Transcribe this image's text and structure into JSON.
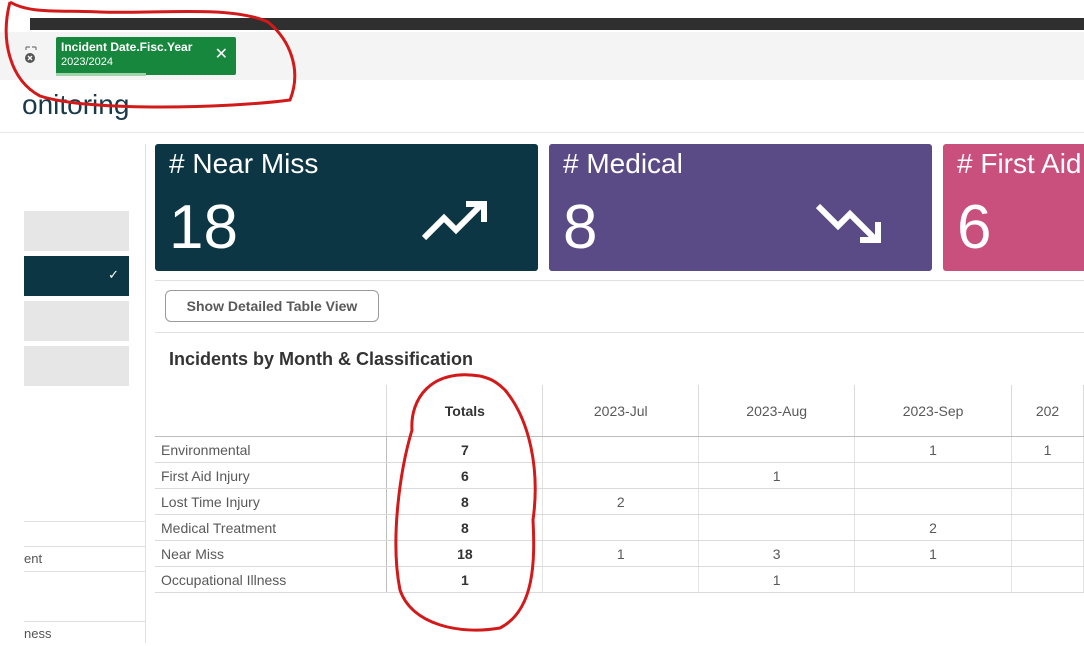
{
  "selection": {
    "chip_field": "Incident Date.Fisc.Year",
    "chip_value": "2023/2024",
    "chip_close": "✕"
  },
  "page": {
    "title": "onitoring"
  },
  "left_panel": {
    "selected_check": "✓",
    "rows": [
      "",
      "ent",
      "",
      "ness"
    ]
  },
  "kpis": [
    {
      "label": "# Near Miss",
      "value": "18",
      "trend": "up",
      "color": "#0d3644"
    },
    {
      "label": "# Medical",
      "value": "8",
      "trend": "down",
      "color": "#5a4a86"
    },
    {
      "label": "# First Aid",
      "value": "6",
      "trend": "",
      "color": "#c94f7c"
    }
  ],
  "buttons": {
    "detail_view": "Show Detailed Table View"
  },
  "table": {
    "title": "Incidents by Month & Classification",
    "headers": [
      "",
      "Totals",
      "2023-Jul",
      "2023-Aug",
      "2023-Sep",
      "202"
    ],
    "rows": [
      {
        "label": "Environmental",
        "cells": [
          "7",
          "",
          "",
          "1",
          "1"
        ]
      },
      {
        "label": "First Aid Injury",
        "cells": [
          "6",
          "",
          "1",
          "",
          ""
        ]
      },
      {
        "label": "Lost Time Injury",
        "cells": [
          "8",
          "2",
          "",
          "",
          ""
        ]
      },
      {
        "label": "Medical Treatment",
        "cells": [
          "8",
          "",
          "",
          "2",
          ""
        ]
      },
      {
        "label": "Near Miss",
        "cells": [
          "18",
          "1",
          "3",
          "1",
          ""
        ]
      },
      {
        "label": "Occupational Illness",
        "cells": [
          "1",
          "",
          "1",
          "",
          ""
        ]
      }
    ]
  },
  "colors": {
    "selection_green": "#17873e",
    "annotation_red": "#d21a1a"
  }
}
